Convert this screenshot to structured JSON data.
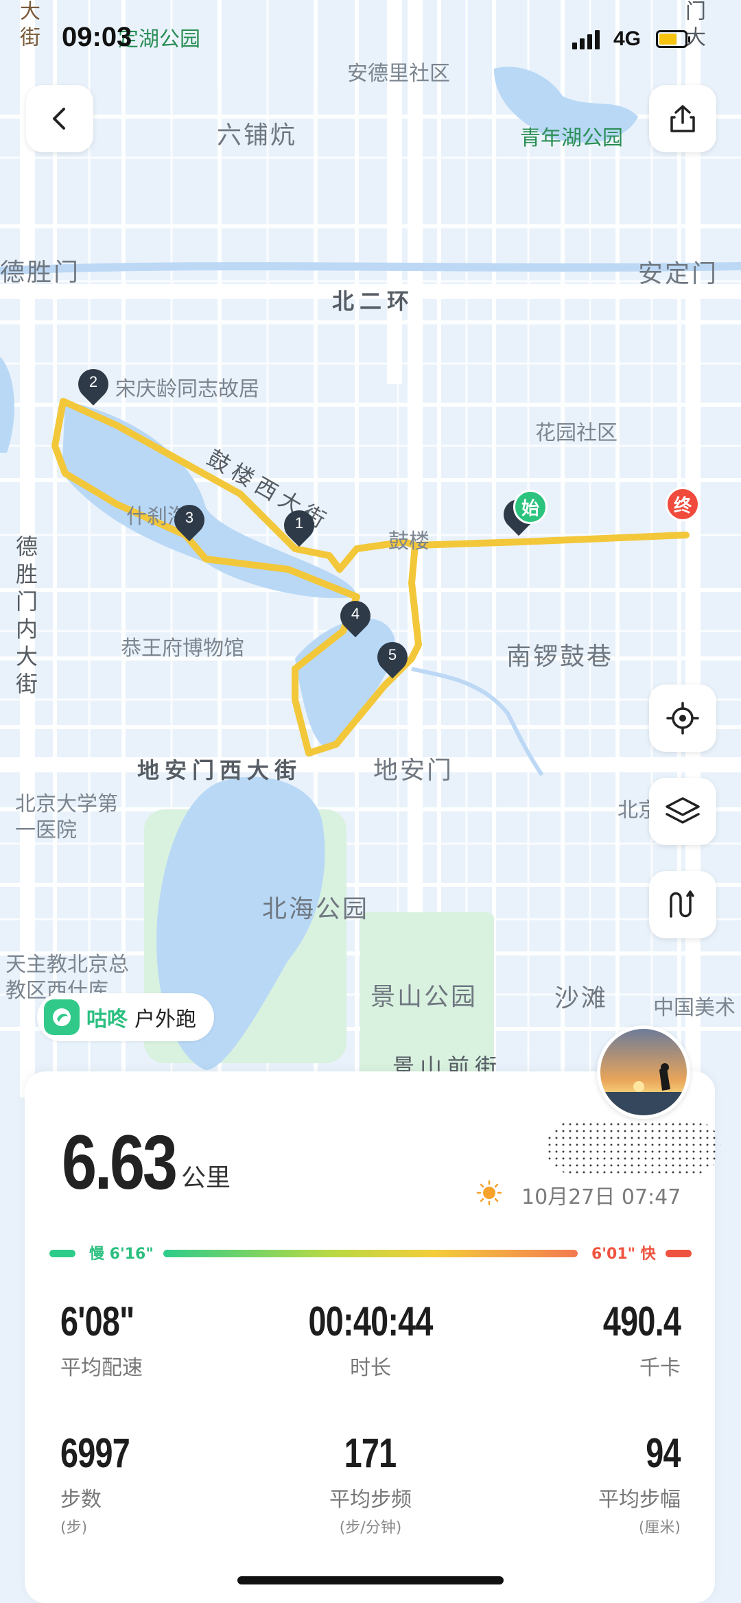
{
  "status_bar": {
    "time": "09:03",
    "network": "4G"
  },
  "map": {
    "labels": {
      "ding_lake_park": "定湖公园",
      "ande_community": "安德里社区",
      "qingnian_lake_park": "青年湖公园",
      "liupukang": "六铺炕",
      "deshengmen": "德胜门",
      "andingmen": "安定门",
      "north_2nd_ring": "北二环",
      "soong_residence": "宋庆龄同志故居",
      "gulou_west_street": "鼓楼西大街",
      "huayuan_community": "花园社区",
      "shichahai": "什刹海",
      "gulou": "鼓楼",
      "deshengmen_inner_street": "德胜门内大街",
      "prince_gong_museum": "恭王府博物馆",
      "nanluoguxiang": "南锣鼓巷",
      "dianmen_west_street": "地安门西大街",
      "dianmen": "地安门",
      "pku_hospital": "北京大学第一医院",
      "beihai_park": "北海公园",
      "catholic_church": "天主教北京总教区西什库",
      "jingshan_park": "景山公园",
      "shatan": "沙滩",
      "art_museum": "中国美术",
      "jingshan_front_street": "景山前街",
      "top_right_street": "门大",
      "top_left_street": "大街",
      "right_hospital": "北京医院"
    },
    "route_color": "#f3c73a",
    "markers": [
      "1",
      "2",
      "3",
      "4",
      "5"
    ],
    "start_label": "始",
    "end_label": "终"
  },
  "brand": {
    "name": "咕咚",
    "activity": "户外跑",
    "color": "#2bbf7f"
  },
  "summary": {
    "distance": "6.63",
    "distance_unit": "公里",
    "datetime": "10月27日 07:47",
    "weather_icon": "sun-icon"
  },
  "pace_bar": {
    "slow_label": "慢 6'16\"",
    "fast_label": "6'01\" 快"
  },
  "stats": {
    "avg_pace": {
      "value": "6'08\"",
      "label": "平均配速"
    },
    "duration": {
      "value": "00:40:44",
      "label": "时长"
    },
    "calories": {
      "value": "490.4",
      "label": "千卡"
    },
    "steps": {
      "value": "6997",
      "label": "步数",
      "unit": "(步)"
    },
    "cadence": {
      "value": "171",
      "label": "平均步频",
      "unit": "(步/分钟)"
    },
    "stride": {
      "value": "94",
      "label": "平均步幅",
      "unit": "(厘米)"
    }
  }
}
